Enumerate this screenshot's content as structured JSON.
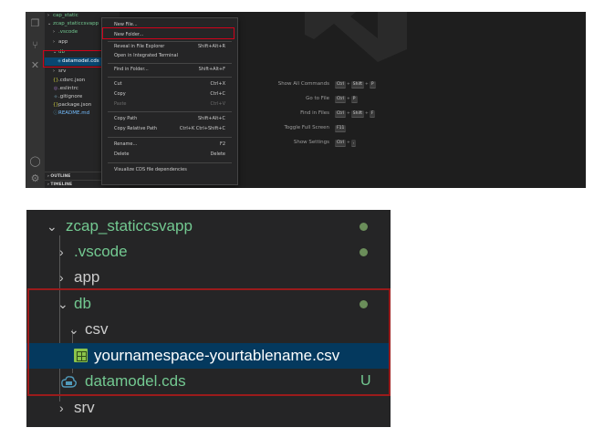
{
  "top": {
    "explorer": {
      "items": [
        {
          "label": "cap_static",
          "chev": "›"
        },
        {
          "label": "zcap_staticcsvapp",
          "chev": "⌄"
        },
        {
          "label": ".vscode",
          "chev": "›"
        },
        {
          "label": "app",
          "chev": "›"
        },
        {
          "label": "db",
          "chev": "⌄"
        },
        {
          "label": "datamodel.cds",
          "chev": ""
        },
        {
          "label": "srv",
          "chev": "›"
        },
        {
          "label": ".cdsrc.json",
          "glyph": "{}"
        },
        {
          "label": ".eslintrc",
          "glyph": "◎"
        },
        {
          "label": ".gitignore",
          "glyph": "◆"
        },
        {
          "label": "package.json",
          "glyph": "{}"
        },
        {
          "label": "README.md",
          "glyph": "ⓘ"
        }
      ],
      "outline_label": "OUTLINE",
      "timeline_label": "TIMELINE"
    },
    "context_menu": {
      "items": [
        {
          "label": "New File...",
          "shortcut": ""
        },
        {
          "label": "New Folder...",
          "shortcut": ""
        },
        {
          "label": "Reveal in File Explorer",
          "shortcut": "Shift+Alt+R"
        },
        {
          "label": "Open in Integrated Terminal",
          "shortcut": ""
        },
        {
          "label": "Find in Folder...",
          "shortcut": "Shift+Alt+F"
        },
        {
          "label": "Cut",
          "shortcut": "Ctrl+X"
        },
        {
          "label": "Copy",
          "shortcut": "Ctrl+C"
        },
        {
          "label": "Paste",
          "shortcut": "Ctrl+V"
        },
        {
          "label": "Copy Path",
          "shortcut": "Shift+Alt+C"
        },
        {
          "label": "Copy Relative Path",
          "shortcut": "Ctrl+K Ctrl+Shift+C"
        },
        {
          "label": "Rename...",
          "shortcut": "F2"
        },
        {
          "label": "Delete",
          "shortcut": "Delete"
        },
        {
          "label": "Visualize CDS file dependencies",
          "shortcut": ""
        }
      ]
    },
    "hints": [
      {
        "label": "Show All Commands",
        "keys": [
          "Ctrl",
          "Shift",
          "P"
        ]
      },
      {
        "label": "Go to File",
        "keys": [
          "Ctrl",
          "P"
        ]
      },
      {
        "label": "Find in Files",
        "keys": [
          "Ctrl",
          "Shift",
          "F"
        ]
      },
      {
        "label": "Toggle Full Screen",
        "keys": [
          "F11"
        ]
      },
      {
        "label": "Show Settings",
        "keys": [
          "Ctrl",
          ","
        ]
      }
    ]
  },
  "bottom": {
    "rows": [
      {
        "label": "zcap_staticcsvapp",
        "chev": "⌄",
        "status": "dot"
      },
      {
        "label": ".vscode",
        "chev": "›",
        "status": "dot"
      },
      {
        "label": "app",
        "chev": "›",
        "status": ""
      },
      {
        "label": "db",
        "chev": "⌄",
        "status": "dot"
      },
      {
        "label": "csv",
        "chev": "⌄",
        "status": ""
      },
      {
        "label": "yournamespace-yourtablename.csv",
        "chev": "",
        "status": ""
      },
      {
        "label": "datamodel.cds",
        "chev": "",
        "status": "U"
      },
      {
        "label": "srv",
        "chev": "›",
        "status": ""
      }
    ],
    "colors": {
      "modified_dot": "#6b8e5a",
      "untracked": "#73c991",
      "selection": "#04395e",
      "highlight_border": "#9b1b1b"
    }
  }
}
